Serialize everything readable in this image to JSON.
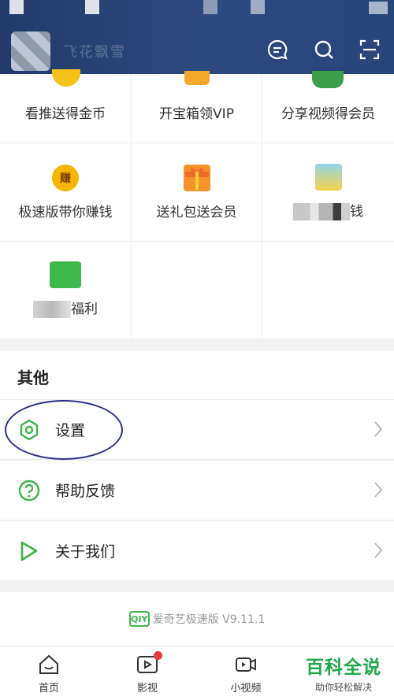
{
  "header": {
    "user_name": "飞花飘雪",
    "icons": [
      "message-icon",
      "search-icon",
      "scan-icon"
    ]
  },
  "grid": {
    "items": [
      {
        "label": "看推送得金币",
        "icon": "coin-icon"
      },
      {
        "label": "开宝箱领VIP",
        "icon": "treasure-box-icon"
      },
      {
        "label": "分享视频得会员",
        "icon": "share-icon"
      },
      {
        "label": "极速版带你赚钱",
        "icon": "earn-icon",
        "icon_text": "赚"
      },
      {
        "label": "送礼包送会员",
        "icon": "gift-icon"
      },
      {
        "label": "钱",
        "icon": "card-icon"
      },
      {
        "label": "福利",
        "icon": "newbie-icon"
      }
    ]
  },
  "other": {
    "title": "其他",
    "items": [
      {
        "label": "设置",
        "icon": "settings-icon"
      },
      {
        "label": "帮助反馈",
        "icon": "help-icon"
      },
      {
        "label": "关于我们",
        "icon": "about-icon"
      }
    ]
  },
  "version": {
    "logo_text": "QIY",
    "text": "爱奇艺极速版 V9.11.1"
  },
  "bottom_nav": {
    "items": [
      {
        "label": "首页",
        "icon": "home-icon"
      },
      {
        "label": "影视",
        "icon": "video-icon",
        "badge": true
      },
      {
        "label": "小视频",
        "icon": "short-video-icon"
      }
    ]
  },
  "watermark": {
    "title": "百科全说",
    "subtitle": "助你轻松解决"
  },
  "colors": {
    "accent": "#3bb34a",
    "header": "#2d4a80",
    "badge": "#e83a3a",
    "annotation": "#2d2f8f"
  }
}
